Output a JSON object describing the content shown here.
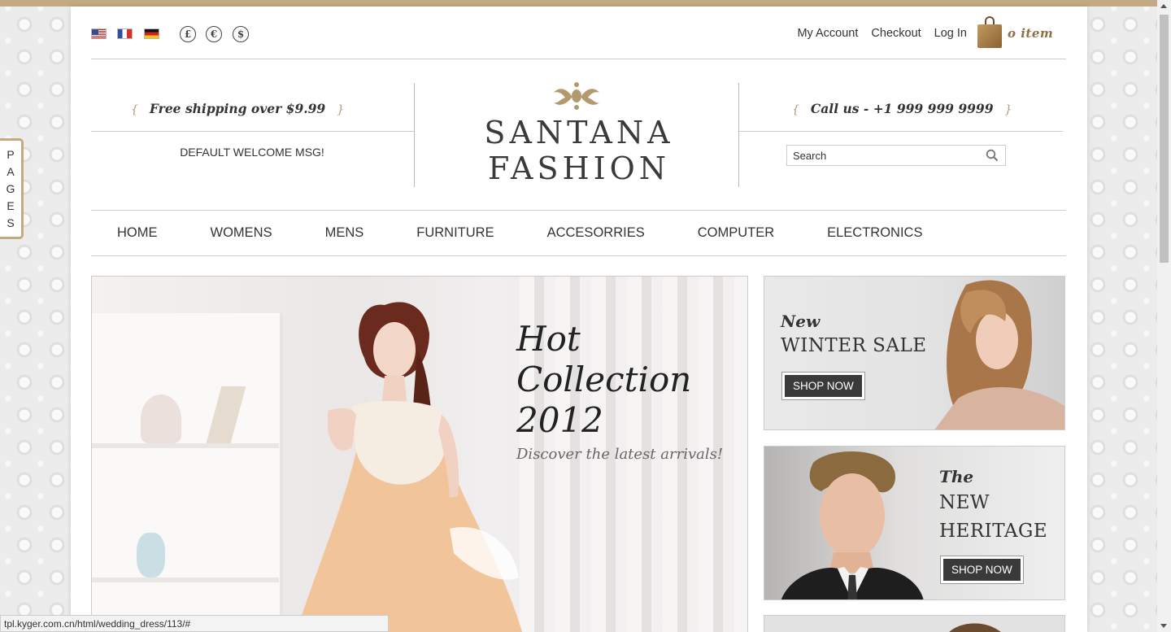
{
  "colors": {
    "accent": "#c2ab84",
    "text": "#333333",
    "button": "#3a3a3a"
  },
  "languages": [
    {
      "icon": "flag-us-icon"
    },
    {
      "icon": "flag-fr-icon"
    },
    {
      "icon": "flag-de-icon"
    }
  ],
  "currencies": [
    "£",
    "€",
    "$"
  ],
  "top_links": {
    "my_account": "My Account",
    "checkout": "Checkout",
    "log_in": "Log In"
  },
  "cart": {
    "icon": "shopping-bag-icon",
    "count_label": "o item"
  },
  "header": {
    "free_shipping": "Free shipping over $9.99",
    "welcome": "DEFAULT WELCOME MSG!",
    "logo_line1": "SANTANA",
    "logo_line2": "FASHION",
    "call_us": "Call us - +1 999 999 9999",
    "brace_open": "{",
    "brace_close": "}"
  },
  "search": {
    "placeholder": "Search",
    "icon": "search-icon"
  },
  "nav": [
    "HOME",
    "WOMENS",
    "MENS",
    "FURNITURE",
    "ACCESORRIES",
    "COMPUTER",
    "ELECTRONICS"
  ],
  "hero": {
    "title_line1": "Hot",
    "title_line2": "Collection",
    "title_line3": "2012",
    "subtitle": "Discover the latest arrivals!"
  },
  "banners": [
    {
      "kicker": "New",
      "headline_line1": "WINTER SALE",
      "headline_line2": "",
      "button": "SHOP NOW"
    },
    {
      "kicker": "The",
      "headline_line1": "NEW",
      "headline_line2": "HERITAGE",
      "button": "SHOP NOW"
    }
  ],
  "pages_tab": [
    "P",
    "A",
    "G",
    "E",
    "S"
  ],
  "status_bar": "tpl.kyger.com.cn/html/wedding_dress/113/#"
}
